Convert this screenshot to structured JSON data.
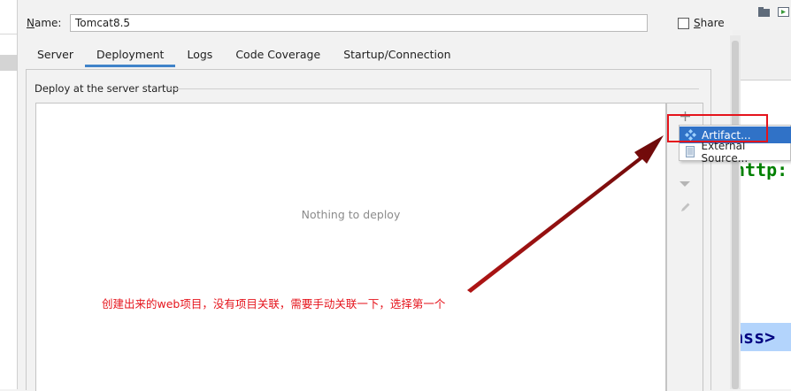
{
  "dialog": {
    "name_label_prefix": "N",
    "name_label_rest": "ame:",
    "name_value": "Tomcat8.5",
    "share_label_prefix": "S",
    "share_label_rest": "hare",
    "share_checked": false
  },
  "tabs": [
    {
      "label": "Server",
      "active": false
    },
    {
      "label": "Deployment",
      "active": true
    },
    {
      "label": "Logs",
      "active": false
    },
    {
      "label": "Code Coverage",
      "active": false
    },
    {
      "label": "Startup/Connection",
      "active": false
    }
  ],
  "deployment": {
    "section_title": "Deploy at the server startup",
    "empty_text": "Nothing to deploy",
    "toolbar_icons": [
      "plus-icon",
      "move-down-icon",
      "edit-icon"
    ]
  },
  "popup_menu": {
    "items": [
      {
        "label": "Artifact...",
        "icon": "artifact-icon",
        "selected": true
      },
      {
        "label": "External Source...",
        "icon": "external-source-icon",
        "selected": false
      }
    ]
  },
  "editor": {
    "code_fragment_1": "http:",
    "code_fragment_2": "ass>"
  },
  "annotation": {
    "text": "创建出来的web项目，没有项目关联，需要手动关联一下，选择第一个",
    "color": "#e5141c"
  },
  "colors": {
    "accent": "#4083c9",
    "selection": "#3072c7",
    "annotation_red": "#e5141c",
    "arrow": "#8b0d0d"
  }
}
